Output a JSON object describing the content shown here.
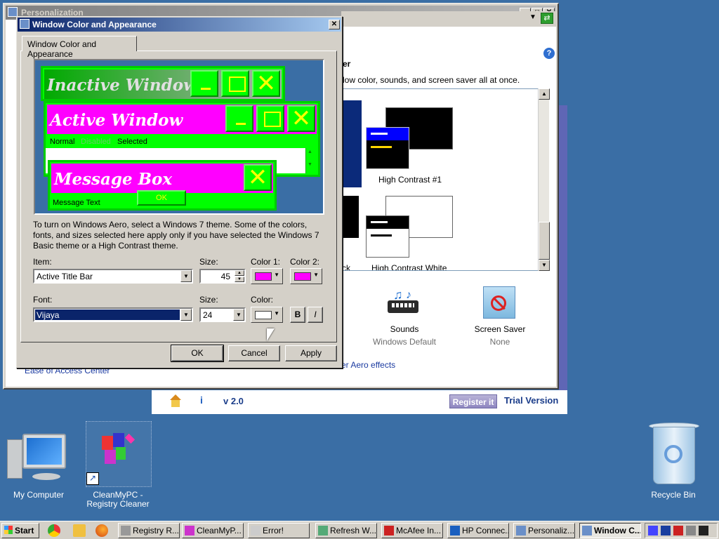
{
  "personalization": {
    "title": "Personalization",
    "heading": "ter",
    "description": "dow color, sounds, and screen saver all at once.",
    "themes": [
      {
        "name": "High Contrast #1"
      },
      {
        "name": "High Contrast White"
      },
      {
        "name": "ck"
      }
    ],
    "sounds_label": "Sounds",
    "sounds_value": "Windows Default",
    "screensaver_label": "Screen Saver",
    "screensaver_value": "None",
    "ease_link": "Ease of Access Center",
    "aero_link": "er Aero effects"
  },
  "cleanmypc": {
    "version": "v 2.0",
    "register": "Register it",
    "trial": "Trial Version"
  },
  "dialog": {
    "title": "Window Color and Appearance",
    "tab": "Window Color and Appearance",
    "preview": {
      "inactive_title": "Inactive Window",
      "active_title": "Active Window",
      "menu_normal": "Normal",
      "menu_disabled": "Disabled",
      "menu_selected": "Selected",
      "message_title": "Message Box",
      "message_text": "Message Text",
      "ok": "OK"
    },
    "info_text": "To turn on Windows Aero, select a Windows 7 theme.  Some of the colors, fonts, and sizes selected here apply only if you have selected the Windows 7 Basic theme or a High Contrast theme.",
    "item_label": "Item:",
    "item_value": "Active Title Bar",
    "size_label": "Size:",
    "size_value": "45",
    "color1_label": "Color 1:",
    "color2_label": "Color 2:",
    "color1": "#ff00ff",
    "color2": "#ff00ff",
    "font_label": "Font:",
    "font_value": "Vijaya",
    "font_size_label": "Size:",
    "font_size_value": "24",
    "font_color_label": "Color:",
    "font_color": "#ffffff",
    "bold": "B",
    "italic": "I",
    "ok": "OK",
    "cancel": "Cancel",
    "apply": "Apply"
  },
  "desktop": {
    "icons": [
      {
        "label": "My Computer"
      },
      {
        "label": "CleanMyPC - Registry Cleaner"
      },
      {
        "label": "Recycle Bin"
      }
    ]
  },
  "taskbar": {
    "start": "Start",
    "tasks": [
      {
        "label": "Registry R..."
      },
      {
        "label": "CleanMyP..."
      },
      {
        "label": "Error!"
      },
      {
        "label": "Refresh W..."
      },
      {
        "label": "McAfee In..."
      },
      {
        "label": "HP Connec..."
      },
      {
        "label": "Personaliz..."
      },
      {
        "label": "Window C..."
      }
    ]
  }
}
